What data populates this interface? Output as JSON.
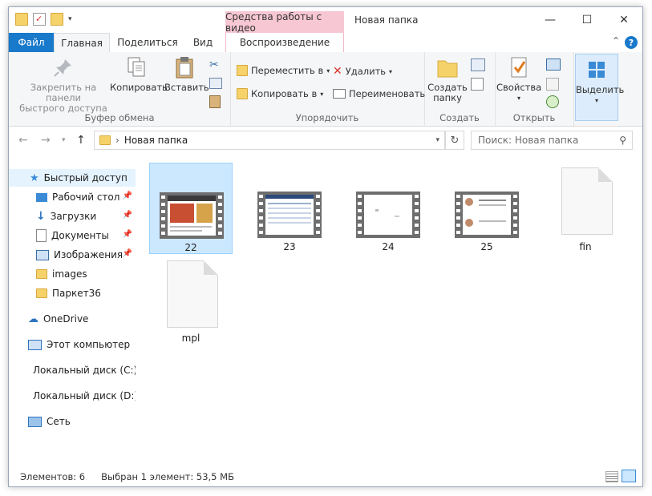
{
  "window": {
    "title": "Новая папка",
    "context_tab_title": "Средства работы с видео",
    "minimize": "—",
    "maximize": "☐",
    "close": "✕"
  },
  "tabs": {
    "file": "Файл",
    "home": "Главная",
    "share": "Поделиться",
    "view": "Вид",
    "playback": "Воспроизведение"
  },
  "ribbon": {
    "clipboard": {
      "label": "Буфер обмена",
      "pin": "Закрепить на панели быстрого доступа",
      "pin_line1": "Закрепить на панели",
      "pin_line2": "быстрого доступа",
      "copy": "Копировать",
      "paste": "Вставить"
    },
    "organize": {
      "label": "Упорядочить",
      "move_to": "Переместить в",
      "copy_to": "Копировать в",
      "delete": "Удалить",
      "rename": "Переименовать"
    },
    "create": {
      "label": "Создать",
      "new_folder_line1": "Создать",
      "new_folder_line2": "папку"
    },
    "open": {
      "label": "Открыть",
      "properties": "Свойства"
    },
    "select": {
      "label": "Выделить"
    }
  },
  "address": {
    "path": "Новая папка",
    "search_placeholder": "Поиск: Новая папка"
  },
  "nav": {
    "quick_access": "Быстрый доступ",
    "items": [
      {
        "label": "Рабочий стол"
      },
      {
        "label": "Загрузки"
      },
      {
        "label": "Документы"
      },
      {
        "label": "Изображения"
      },
      {
        "label": "images"
      },
      {
        "label": "Паркет36"
      }
    ],
    "onedrive": "OneDrive",
    "this_pc": "Этот компьютер",
    "disk_c": "Локальный диск (C:)",
    "disk_d": "Локальный диск (D:)",
    "network": "Сеть"
  },
  "files": [
    {
      "name": "22",
      "kind": "video"
    },
    {
      "name": "23",
      "kind": "video"
    },
    {
      "name": "24",
      "kind": "video"
    },
    {
      "name": "25",
      "kind": "video"
    },
    {
      "name": "fin",
      "kind": "file"
    },
    {
      "name": "mpl",
      "kind": "file"
    }
  ],
  "status": {
    "count": "Элементов: 6",
    "selection": "Выбран 1 элемент: 53,5 МБ"
  },
  "colors": {
    "accent": "#1979ca",
    "context_tab": "#f7c7d4",
    "selection": "#cce8ff"
  }
}
